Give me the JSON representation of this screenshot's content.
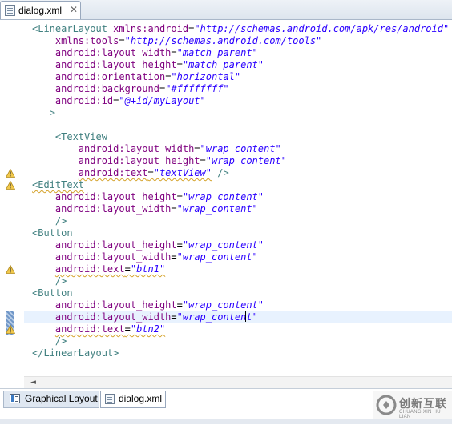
{
  "editor_tab": {
    "title": "dialog.xml",
    "close_glyph": "✕"
  },
  "code_lines": [
    [
      {
        "t": "tg",
        "v": "<LinearLayout "
      },
      {
        "t": "an",
        "v": "xmlns:android"
      },
      {
        "t": "pn",
        "v": "="
      },
      {
        "t": "av",
        "v": "\"http://schemas.android.com/apk/res/android\""
      }
    ],
    [
      {
        "t": "pn",
        "v": "    "
      },
      {
        "t": "an",
        "v": "xmlns:tools"
      },
      {
        "t": "pn",
        "v": "="
      },
      {
        "t": "av",
        "v": "\"http://schemas.android.com/tools\""
      }
    ],
    [
      {
        "t": "pn",
        "v": "    "
      },
      {
        "t": "an",
        "v": "android:layout_width"
      },
      {
        "t": "pn",
        "v": "="
      },
      {
        "t": "av",
        "v": "\"match_parent\""
      }
    ],
    [
      {
        "t": "pn",
        "v": "    "
      },
      {
        "t": "an",
        "v": "android:layout_height"
      },
      {
        "t": "pn",
        "v": "="
      },
      {
        "t": "av",
        "v": "\"match_parent\""
      }
    ],
    [
      {
        "t": "pn",
        "v": "    "
      },
      {
        "t": "an",
        "v": "android:orientation"
      },
      {
        "t": "pn",
        "v": "="
      },
      {
        "t": "av",
        "v": "\"horizontal\""
      }
    ],
    [
      {
        "t": "pn",
        "v": "    "
      },
      {
        "t": "an",
        "v": "android:background"
      },
      {
        "t": "pn",
        "v": "="
      },
      {
        "t": "av",
        "v": "\"#ffffffff\""
      }
    ],
    [
      {
        "t": "pn",
        "v": "    "
      },
      {
        "t": "an",
        "v": "android:id"
      },
      {
        "t": "pn",
        "v": "="
      },
      {
        "t": "av",
        "v": "\"@+id/myLayout\""
      }
    ],
    [
      {
        "t": "pn",
        "v": "   "
      },
      {
        "t": "tg",
        "v": ">"
      }
    ],
    [
      {
        "t": "pn",
        "v": ""
      }
    ],
    [
      {
        "t": "pn",
        "v": "    "
      },
      {
        "t": "tg",
        "v": "<TextView"
      }
    ],
    [
      {
        "t": "pn",
        "v": "        "
      },
      {
        "t": "an",
        "v": "android:layout_width"
      },
      {
        "t": "pn",
        "v": "="
      },
      {
        "t": "av",
        "v": "\"wrap_content\""
      }
    ],
    [
      {
        "t": "pn",
        "v": "        "
      },
      {
        "t": "an",
        "v": "android:layout_height"
      },
      {
        "t": "pn",
        "v": "="
      },
      {
        "t": "av",
        "v": "\"wrap_content\""
      }
    ],
    [
      {
        "t": "pn",
        "v": "        "
      },
      {
        "t": "an",
        "v": "android:text",
        "s": true
      },
      {
        "t": "pn",
        "v": "=",
        "s": true
      },
      {
        "t": "av",
        "v": "\"textView\"",
        "s": true
      },
      {
        "t": "pn",
        "v": " "
      },
      {
        "t": "tg",
        "v": "/>"
      }
    ],
    [
      {
        "t": "tg",
        "v": "<",
        "s": true
      },
      {
        "t": "tg",
        "v": "EditText",
        "s": true
      }
    ],
    [
      {
        "t": "pn",
        "v": "    "
      },
      {
        "t": "an",
        "v": "android:layout_height"
      },
      {
        "t": "pn",
        "v": "="
      },
      {
        "t": "av",
        "v": "\"wrap_content\""
      }
    ],
    [
      {
        "t": "pn",
        "v": "    "
      },
      {
        "t": "an",
        "v": "android:layout_width"
      },
      {
        "t": "pn",
        "v": "="
      },
      {
        "t": "av",
        "v": "\"wrap_content\""
      }
    ],
    [
      {
        "t": "pn",
        "v": "    "
      },
      {
        "t": "tg",
        "v": "/>"
      }
    ],
    [
      {
        "t": "tg",
        "v": "<Button"
      }
    ],
    [
      {
        "t": "pn",
        "v": "    "
      },
      {
        "t": "an",
        "v": "android:layout_height"
      },
      {
        "t": "pn",
        "v": "="
      },
      {
        "t": "av",
        "v": "\"wrap_content\""
      }
    ],
    [
      {
        "t": "pn",
        "v": "    "
      },
      {
        "t": "an",
        "v": "android:layout_width"
      },
      {
        "t": "pn",
        "v": "="
      },
      {
        "t": "av",
        "v": "\"wrap_content\""
      }
    ],
    [
      {
        "t": "pn",
        "v": "    "
      },
      {
        "t": "an",
        "v": "android:text",
        "s": true
      },
      {
        "t": "pn",
        "v": "=",
        "s": true
      },
      {
        "t": "av",
        "v": "\"btn1\"",
        "s": true
      }
    ],
    [
      {
        "t": "pn",
        "v": "    "
      },
      {
        "t": "tg",
        "v": "/>"
      }
    ],
    [
      {
        "t": "tg",
        "v": "<Button"
      }
    ],
    [
      {
        "t": "pn",
        "v": "    "
      },
      {
        "t": "an",
        "v": "android:layout_height"
      },
      {
        "t": "pn",
        "v": "="
      },
      {
        "t": "av",
        "v": "\"wrap_content\""
      }
    ],
    [
      {
        "t": "pn",
        "v": "    "
      },
      {
        "t": "an",
        "v": "android:layout_width"
      },
      {
        "t": "pn",
        "v": "="
      },
      {
        "t": "av",
        "v": "\"wrap_conten"
      },
      {
        "t": "caret",
        "v": ""
      },
      {
        "t": "av",
        "v": "t\""
      }
    ],
    [
      {
        "t": "pn",
        "v": "    "
      },
      {
        "t": "an",
        "v": "android:text",
        "s": true
      },
      {
        "t": "pn",
        "v": "=",
        "s": true
      },
      {
        "t": "av",
        "v": "\"btn2\"",
        "s": true
      }
    ],
    [
      {
        "t": "pn",
        "v": "    "
      },
      {
        "t": "tg",
        "v": "/>"
      }
    ],
    [
      {
        "t": "tg",
        "v": "</LinearLayout>"
      }
    ]
  ],
  "warning_lines": [
    12,
    13,
    20,
    25
  ],
  "current_line": 24,
  "scroll_arrow_glyph": "◄",
  "bottom_tabs": [
    {
      "label": "Graphical Layout",
      "active": false
    },
    {
      "label": "dialog.xml",
      "active": true
    }
  ],
  "watermark": {
    "text": "创新互联",
    "subtext": "CHUANG XIN HU LIAN"
  },
  "colors": {
    "tag": "#3f7f7f",
    "attr_name": "#7f007f",
    "attr_value": "#2a00ff",
    "warning": "#f2c94c"
  }
}
